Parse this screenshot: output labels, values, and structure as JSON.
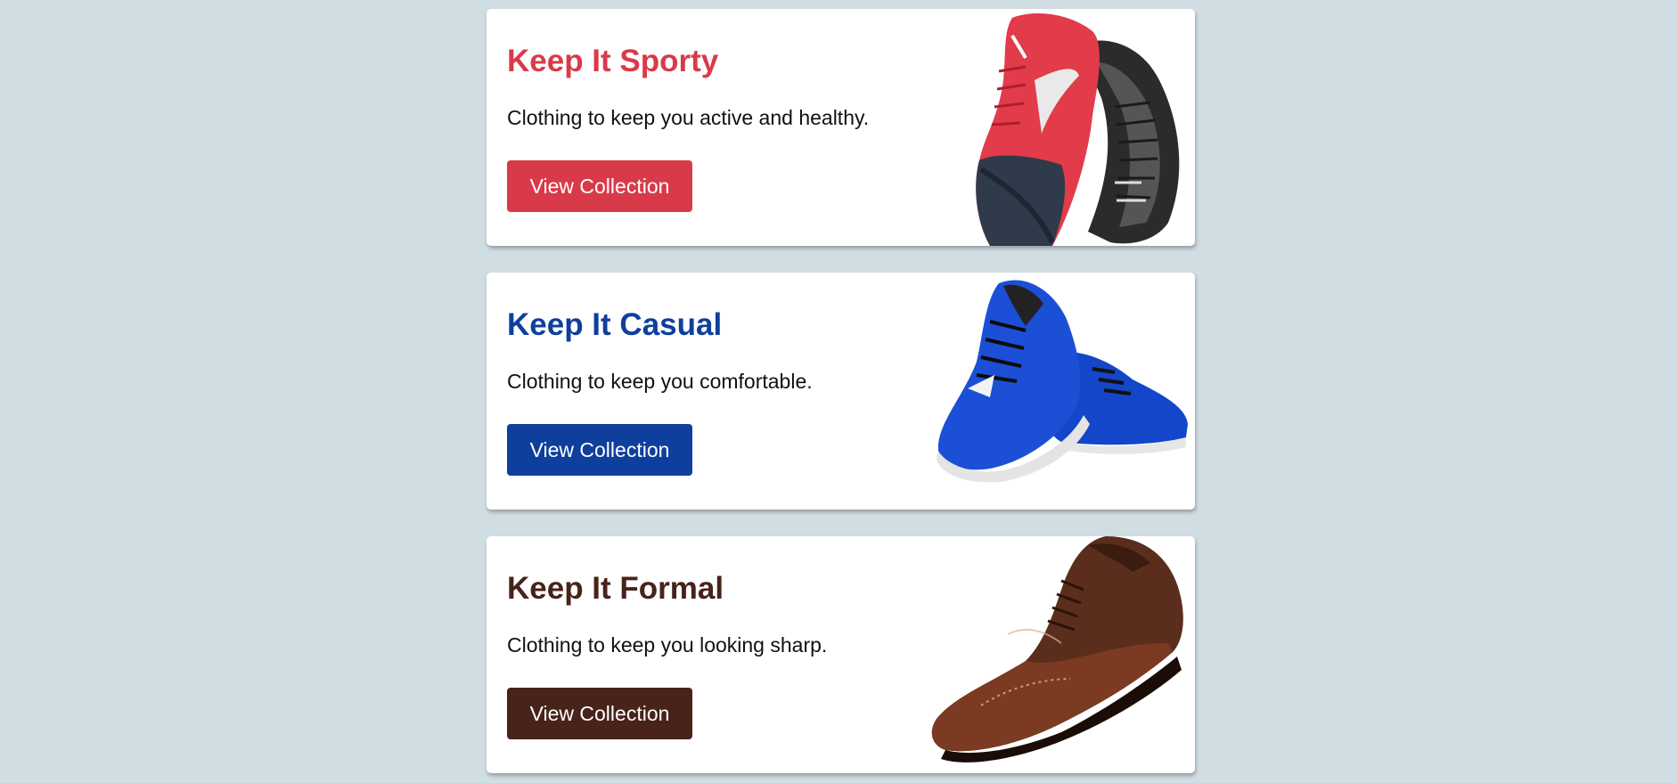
{
  "cards": [
    {
      "title": "Keep It Sporty",
      "description": "Clothing to keep you active and healthy.",
      "button_label": "View Collection",
      "accent": "#d93a49",
      "image": "red-running-shoes-image"
    },
    {
      "title": "Keep It Casual",
      "description": "Clothing to keep you comfortable.",
      "button_label": "View Collection",
      "accent": "#0f3f9c",
      "image": "blue-sneakers-image"
    },
    {
      "title": "Keep It Formal",
      "description": "Clothing to keep you looking sharp.",
      "button_label": "View Collection",
      "accent": "#47231a",
      "image": "brown-oxford-shoe-image"
    }
  ]
}
